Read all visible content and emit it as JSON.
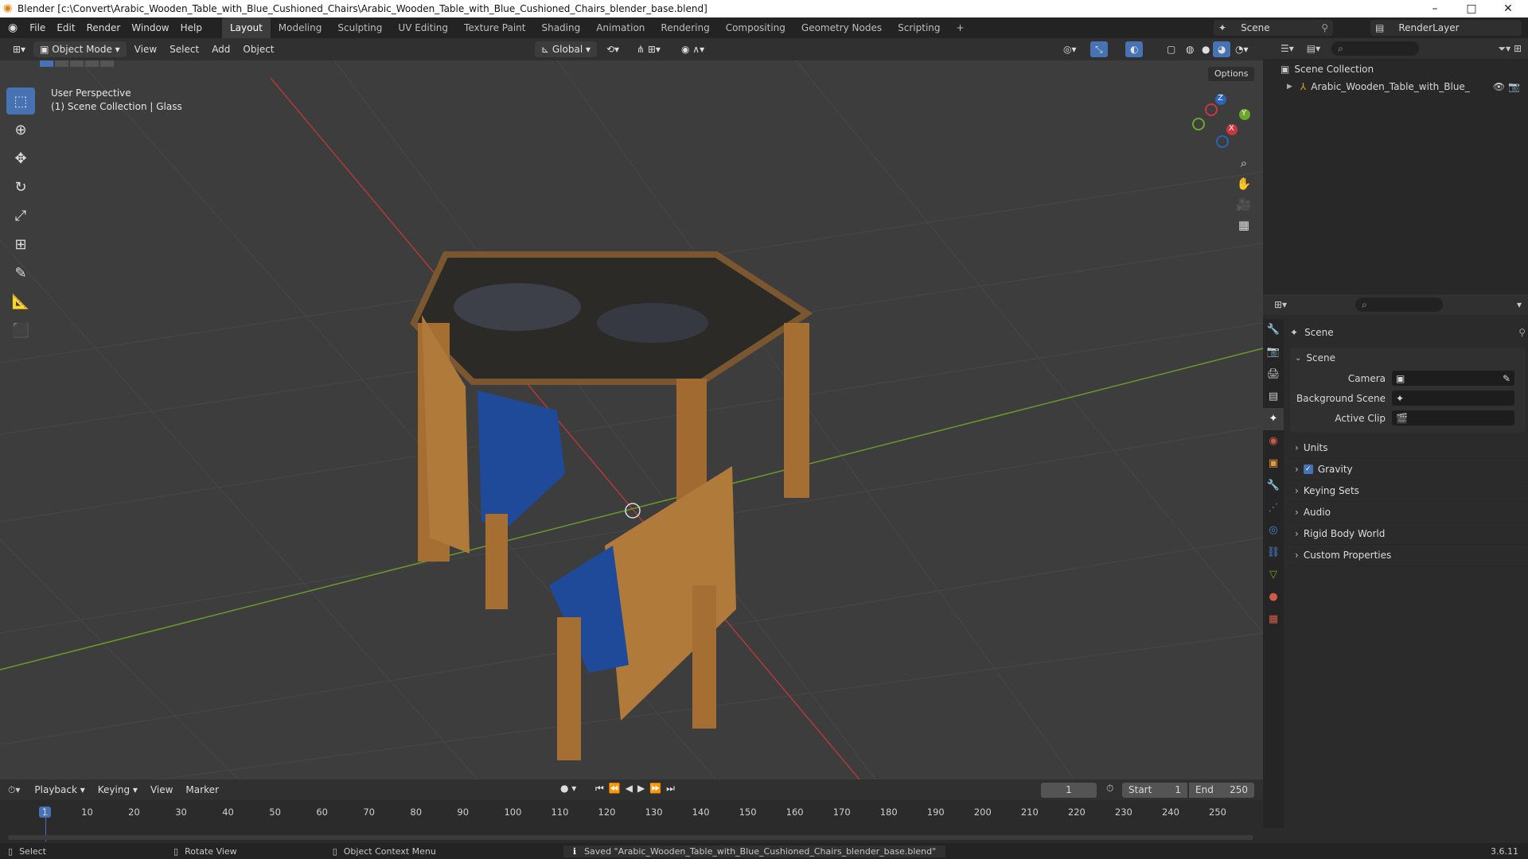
{
  "window": {
    "title": "Blender [c:\\Convert\\Arabic_Wooden_Table_with_Blue_Cushioned_Chairs\\Arabic_Wooden_Table_with_Blue_Cushioned_Chairs_blender_base.blend]",
    "minimize": "–",
    "maximize": "□",
    "close": "✕"
  },
  "menus": [
    "File",
    "Edit",
    "Render",
    "Window",
    "Help"
  ],
  "workspaces": [
    "Layout",
    "Modeling",
    "Sculpting",
    "UV Editing",
    "Texture Paint",
    "Shading",
    "Animation",
    "Rendering",
    "Compositing",
    "Geometry Nodes",
    "Scripting",
    "+"
  ],
  "scene_name": "Scene",
  "view_layer": "RenderLayer",
  "header3d": {
    "mode": "Object Mode",
    "view": "View",
    "select": "Select",
    "add": "Add",
    "object": "Object",
    "orientation": "Global",
    "options": "Options"
  },
  "overlay": {
    "line1": "User Perspective",
    "line2": "(1) Scene Collection | Glass"
  },
  "gizmo": {
    "x": "X",
    "y": "Y",
    "z": "Z"
  },
  "outliner": {
    "root": "Scene Collection",
    "item": "Arabic_Wooden_Table_with_Blue_Cushi"
  },
  "properties": {
    "header": "Scene",
    "panel": "Scene",
    "camera_label": "Camera",
    "bg_scene_label": "Background Scene",
    "active_clip_label": "Active Clip",
    "sections": [
      "Units",
      "Gravity",
      "Keying Sets",
      "Audio",
      "Rigid Body World",
      "Custom Properties"
    ]
  },
  "timeline": {
    "playback": "Playback",
    "keying": "Keying",
    "view": "View",
    "marker": "Marker",
    "current_frame": "1",
    "start_label": "Start",
    "start": "1",
    "end_label": "End",
    "end": "250",
    "ticks": [
      "1",
      "10",
      "20",
      "30",
      "40",
      "50",
      "60",
      "70",
      "80",
      "90",
      "100",
      "110",
      "120",
      "130",
      "140",
      "150",
      "160",
      "170",
      "180",
      "190",
      "200",
      "210",
      "220",
      "230",
      "240",
      "250"
    ]
  },
  "status": {
    "select": "Select",
    "rotate": "Rotate View",
    "context": "Object Context Menu",
    "saved": "Saved \"Arabic_Wooden_Table_with_Blue_Cushioned_Chairs_blender_base.blend\"",
    "version": "3.6.11"
  },
  "colors": {
    "accent": "#4772b3",
    "grid_x": "#b03a3a",
    "grid_y": "#6b9a2a",
    "wood": "#b07a3a",
    "cushion": "#1f4a9a"
  }
}
